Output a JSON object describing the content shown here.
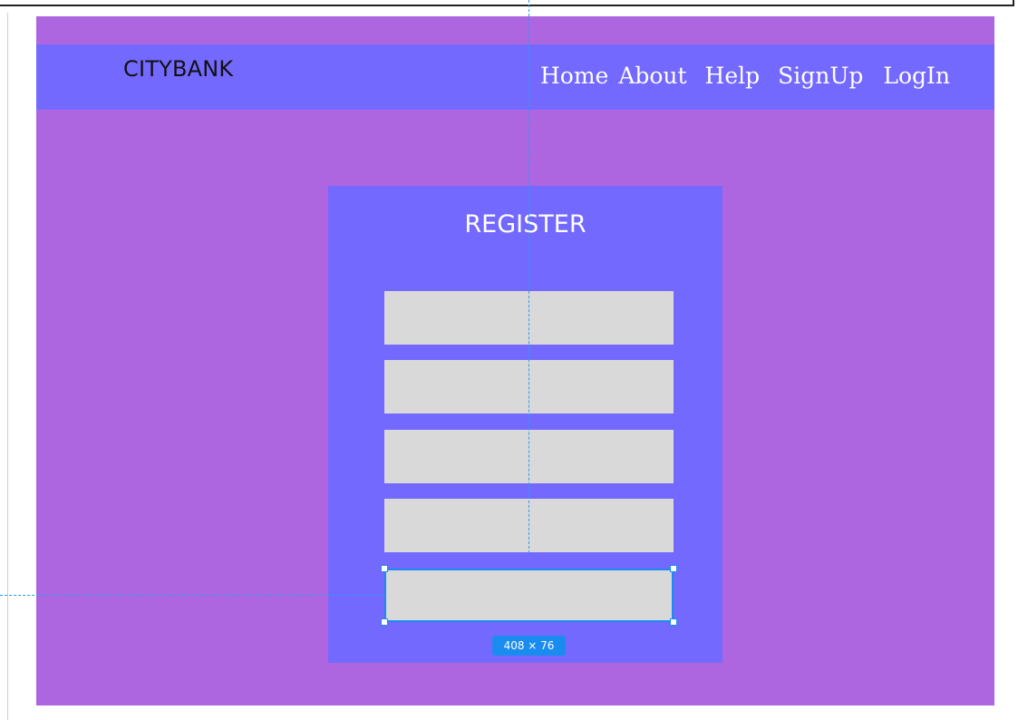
{
  "brand": "CITYBANK",
  "nav": {
    "home": "Home",
    "about": "About",
    "help": "Help",
    "signup": "SignUp",
    "login": "LogIn"
  },
  "register": {
    "title": "REGISTER",
    "fields": [
      "",
      "",
      "",
      "",
      ""
    ]
  },
  "selection": {
    "size_label": "408 × 76"
  },
  "colors": {
    "background": "#ad66e0",
    "navbar": "#7469fe",
    "card": "#7469fe",
    "field": "#d9d9d9",
    "selection": "#1a8cf0"
  }
}
